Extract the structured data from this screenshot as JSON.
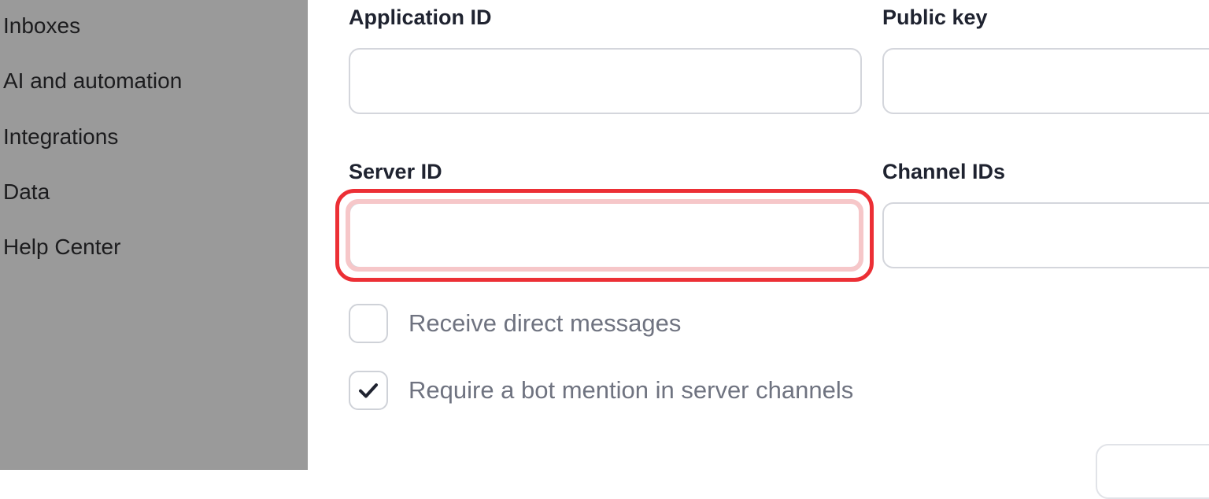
{
  "sidebar": {
    "items": [
      {
        "label": "Inboxes"
      },
      {
        "label": "AI and automation"
      },
      {
        "label": "Integrations"
      },
      {
        "label": "Data"
      },
      {
        "label": "Help Center"
      }
    ]
  },
  "form": {
    "application_id": {
      "label": "Application ID",
      "value": ""
    },
    "public_key": {
      "label": "Public key",
      "value": ""
    },
    "server_id": {
      "label": "Server ID",
      "value": ""
    },
    "channel_ids": {
      "label": "Channel IDs",
      "value": ""
    },
    "receive_dm": {
      "label": "Receive direct messages",
      "checked": false
    },
    "require_mention": {
      "label": "Require a bot mention in server channels",
      "checked": true
    }
  },
  "colors": {
    "highlight": "#ec2f35",
    "sidebar_overlay": "#9a9a9a",
    "check": "#1f2330"
  },
  "icons": {
    "check": "check-icon"
  }
}
